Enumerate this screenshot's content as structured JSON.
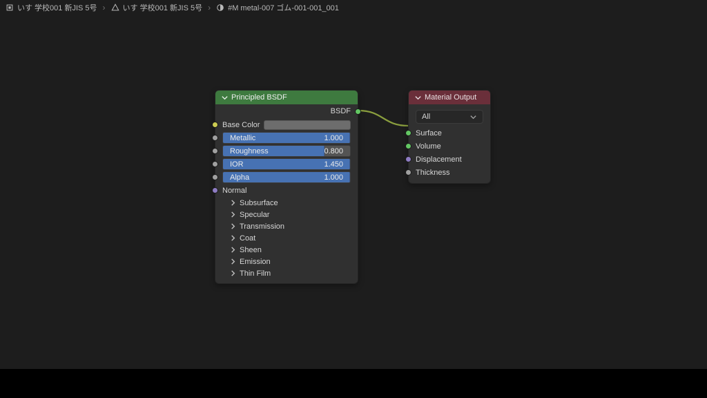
{
  "breadcrumb": {
    "seg1": "いす 学校001 新JIS 5号",
    "seg2": "いす 学校001 新JIS 5号",
    "seg3": "#M metal-007 ゴム-001-001_001"
  },
  "principled": {
    "title": "Principled BSDF",
    "output_label": "BSDF",
    "base_color_label": "Base Color",
    "base_color_hex": "#6d6d6d",
    "sliders": {
      "metallic": {
        "label": "Metallic",
        "value": "1.000",
        "fill_pct": 100
      },
      "roughness": {
        "label": "Roughness",
        "value": "0.800",
        "fill_pct": 80
      },
      "ior": {
        "label": "IOR",
        "value": "1.450",
        "fill_pct": 100
      },
      "alpha": {
        "label": "Alpha",
        "value": "1.000",
        "fill_pct": 100
      }
    },
    "normal_label": "Normal",
    "panels": {
      "subsurface": "Subsurface",
      "specular": "Specular",
      "transmission": "Transmission",
      "coat": "Coat",
      "sheen": "Sheen",
      "emission": "Emission",
      "thinfilm": "Thin Film"
    }
  },
  "material_output": {
    "title": "Material Output",
    "target": "All",
    "inputs": {
      "surface": "Surface",
      "volume": "Volume",
      "displacement": "Displacement",
      "thickness": "Thickness"
    }
  },
  "colors": {
    "wire": "#8a9e3e"
  }
}
